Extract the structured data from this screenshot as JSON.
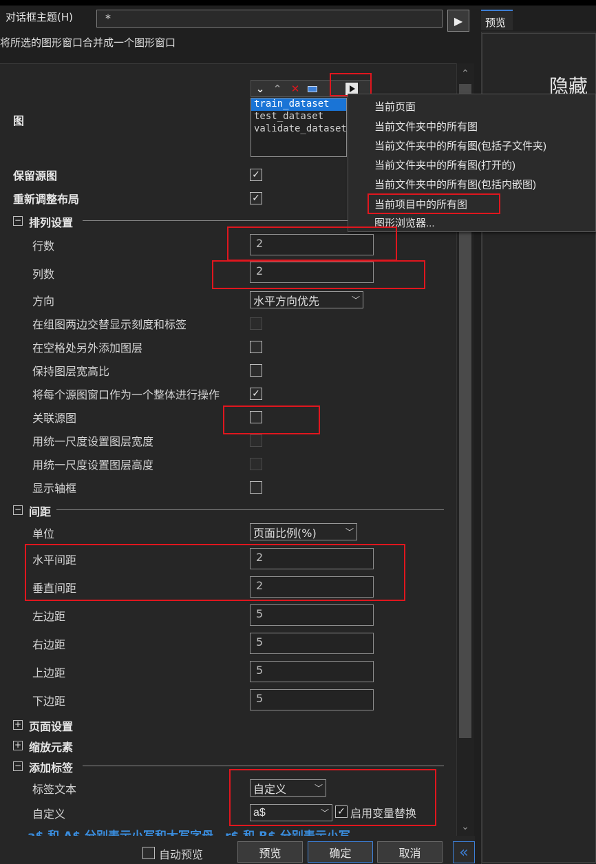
{
  "header": {
    "theme_label": "对话框主题(H)",
    "theme_value": "*",
    "run_icon": "▶",
    "description": "将所选的图形窗口合并成一个图形窗口"
  },
  "preview": {
    "tab_label": "预览",
    "hide_text": "隐藏"
  },
  "graphs": {
    "label": "图",
    "toolbar_icons": [
      "check-down-icon",
      "arrow-up-icon",
      "delete-x-icon",
      "minus-box-icon",
      "play-arrow-icon"
    ],
    "items": [
      "train_dataset",
      "test_dataset",
      "validate_dataset"
    ],
    "selected_index": 0
  },
  "menu": {
    "items": [
      "当前页面",
      "当前文件夹中的所有图",
      "当前文件夹中的所有图(包括子文件夹)",
      "当前文件夹中的所有图(打开的)",
      "当前文件夹中的所有图(包括内嵌图)",
      "当前项目中的所有图",
      "图形浏览器..."
    ],
    "highlighted_index": 5
  },
  "options": {
    "keep_source": {
      "label": "保留源图",
      "checked": true
    },
    "relayout": {
      "label": "重新调整布局",
      "checked": true
    }
  },
  "arrange": {
    "title": "排列设置",
    "rows_label": "行数",
    "rows_value": "2",
    "cols_label": "列数",
    "cols_value": "2",
    "direction_label": "方向",
    "direction_value": "水平方向优先",
    "alt_ticks_label": "在组图两边交替显示刻度和标签",
    "add_layers_label": "在空格处另外添加图层",
    "keep_aspect_label": "保持图层宽高比",
    "as_whole_label": "将每个源图窗口作为一个整体进行操作",
    "link_source_label": "关联源图",
    "uniform_width_label": "用统一尺度设置图层宽度",
    "uniform_height_label": "用统一尺度设置图层高度",
    "show_frame_label": "显示轴框"
  },
  "spacing": {
    "title": "间距",
    "unit_label": "单位",
    "unit_value": "页面比例(%)",
    "h_gap_label": "水平间距",
    "h_gap_value": "2",
    "v_gap_label": "垂直间距",
    "v_gap_value": "2",
    "left_label": "左边距",
    "left_value": "5",
    "right_label": "右边距",
    "right_value": "5",
    "top_label": "上边距",
    "top_value": "5",
    "bottom_label": "下边距",
    "bottom_value": "5"
  },
  "sections": {
    "page_setup": "页面设置",
    "scale_elements": "缩放元素",
    "add_labels": "添加标签"
  },
  "labels": {
    "label_text_label": "标签文本",
    "label_text_value": "自定义",
    "custom_label": "自定义",
    "custom_value": "a$",
    "enable_var_label": "启用变量替换",
    "hint": "a$ 和 A$ 分别表示小写和大写字母，r$ 和 R$ 分别表示小写"
  },
  "footer": {
    "auto_preview_label": "自动预览",
    "preview_button": "预览",
    "ok_button": "确定",
    "cancel_button": "取消",
    "collapse_icon": "«"
  },
  "colors": {
    "highlight_red": "#e0161e",
    "accent_blue": "#3d7fd6",
    "selection_blue": "#1a74d6"
  }
}
